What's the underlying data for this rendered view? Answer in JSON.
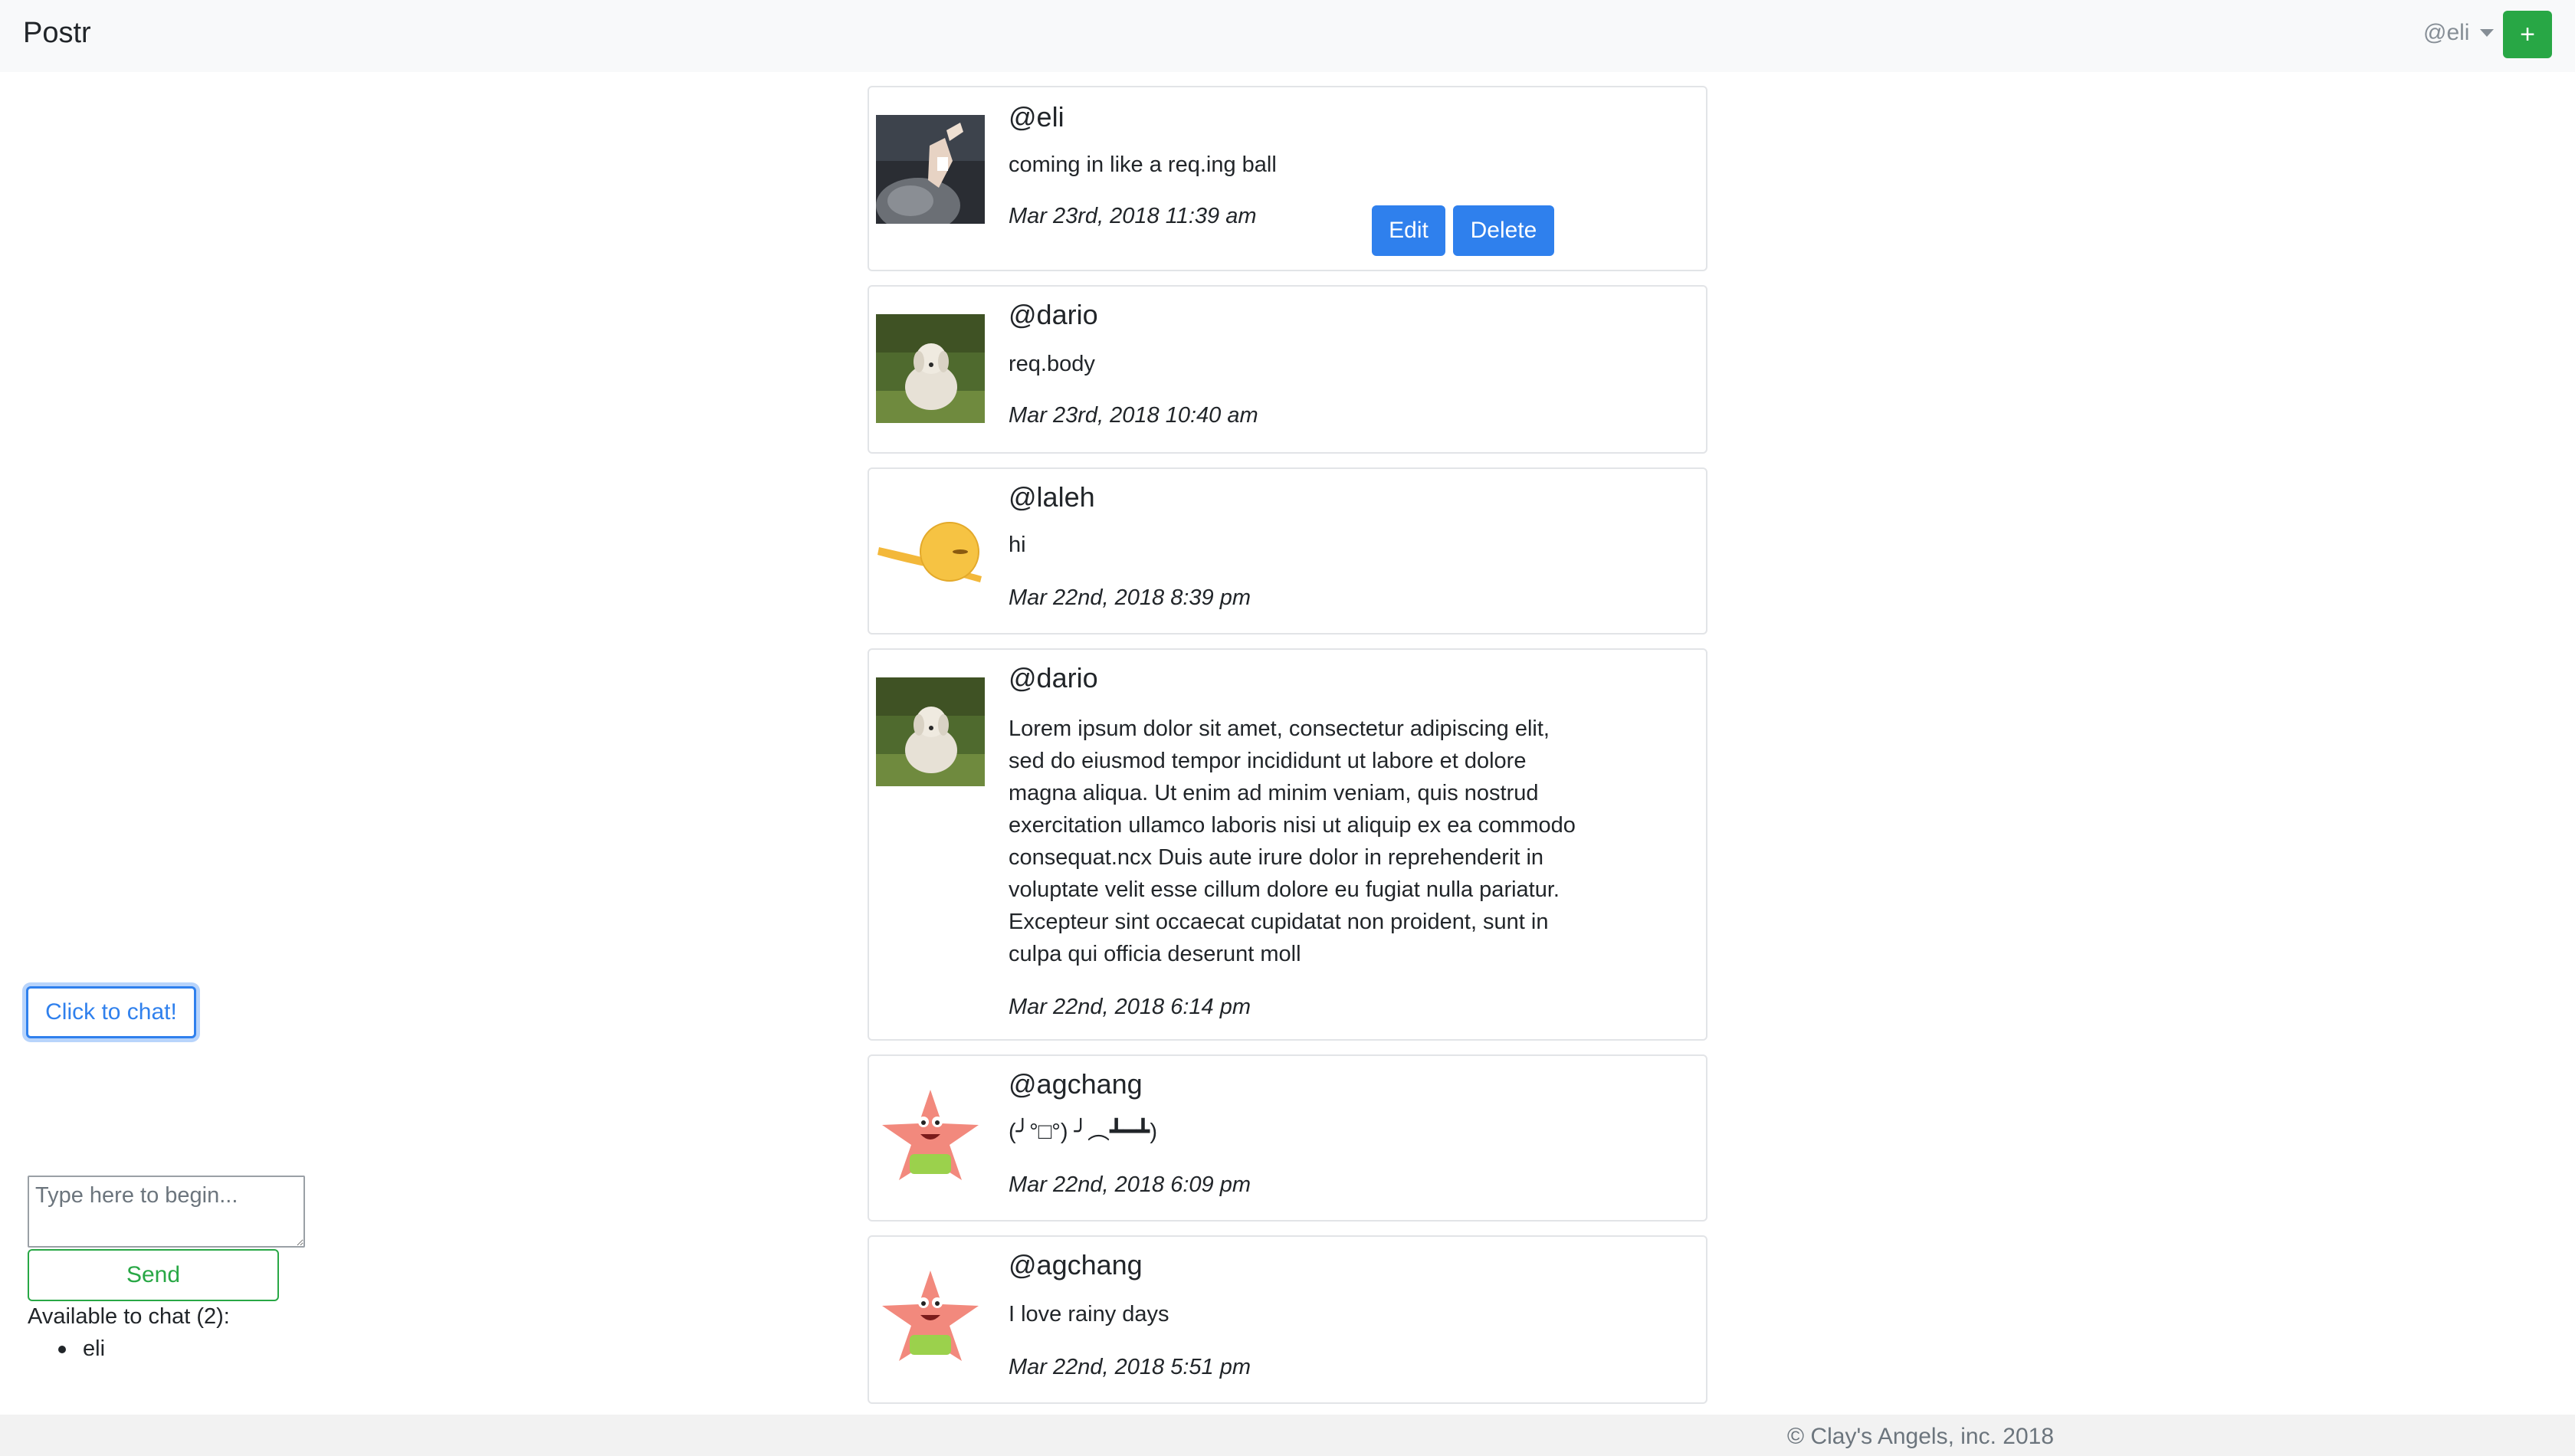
{
  "navbar": {
    "brand": "Postr",
    "user": "@eli",
    "add_label": "+"
  },
  "posts": [
    {
      "username": "@eli",
      "body": "coming in like a req.ing ball",
      "time": "Mar 23rd, 2018 11:39 am",
      "edit_label": "Edit",
      "delete_label": "Delete"
    },
    {
      "username": "@dario",
      "body": "req.body",
      "time": "Mar 23rd, 2018 10:40 am"
    },
    {
      "username": "@laleh",
      "body": "hi",
      "time": "Mar 22nd, 2018 8:39 pm"
    },
    {
      "username": "@dario",
      "body": "Lorem ipsum dolor sit amet, consectetur adipiscing elit, sed do eiusmod tempor incididunt ut labore et dolore magna aliqua. Ut enim ad minim veniam, quis nostrud exercitation ullamco laboris nisi ut aliquip ex ea commodo consequat.ncx Duis aute irure dolor in reprehenderit in voluptate velit esse cillum dolore eu fugiat nulla pariatur. Excepteur sint occaecat cupidatat non proident, sunt in culpa qui officia deserunt moll",
      "time": "Mar 22nd, 2018 6:14 pm"
    },
    {
      "username": "@agchang",
      "body": "(╯°□°) ╯︵┻━┻)",
      "time": "Mar 22nd, 2018 6:09 pm"
    },
    {
      "username": "@agchang",
      "body": "I love rainy days",
      "time": "Mar 22nd, 2018 5:51 pm"
    }
  ],
  "chat": {
    "open_label": "Click to chat!",
    "input_placeholder": "Type here to begin...",
    "send_label": "Send",
    "available_label": "Available to chat (2):",
    "available_users": [
      "eli"
    ]
  },
  "footer": {
    "text": "© Clay's Angels, inc. 2018"
  },
  "colors": {
    "primary": "#2f80ed",
    "success": "#28a745",
    "navbar_bg": "#f8f9fa"
  }
}
